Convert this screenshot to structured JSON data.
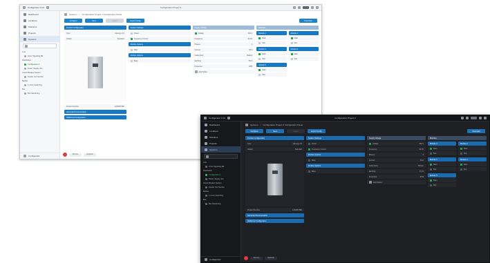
{
  "light": {
    "app_title": "Configurator 2.4.0",
    "window_title": "Configuration Project 1",
    "user_label": "Login",
    "nav": [
      {
        "label": "Dashboard"
      },
      {
        "label": "Locations"
      },
      {
        "label": "Solutions"
      },
      {
        "label": "Projects"
      },
      {
        "label": "Systems"
      }
    ],
    "tree": [
      {
        "label": "Line",
        "group": true
      },
      {
        "label": "xCom Signaling Mk",
        "group": false,
        "sel": false
      },
      {
        "label": "Distribution",
        "group": true
      },
      {
        "label": "Configuration 1",
        "group": false,
        "sel": true
      },
      {
        "label": "Power Supply Unit",
        "group": false,
        "sel": false
      },
      {
        "label": "Circuit Breaker Section",
        "group": true
      },
      {
        "label": "Feeder Unit Section",
        "group": false,
        "sel": false
      },
      {
        "label": "Busbar",
        "group": true
      },
      {
        "label": "1 xCom Switching",
        "group": false,
        "sel": false
      },
      {
        "label": "Bus",
        "group": true
      },
      {
        "label": "Bus Monitoring",
        "group": false,
        "sel": false
      }
    ],
    "footer_label": "Configurator",
    "brand": "EATON",
    "breadcrumb": [
      "Systems",
      "Configuration Project 1 Configuration Panel"
    ],
    "toolbar": [
      "Configure",
      "Save",
      "Import",
      "Export Config",
      "Download"
    ],
    "col1": {
      "head": "Product Configuration",
      "rows": [
        {
          "label": "Type",
          "value": "xEnergy 3.5"
        },
        {
          "label": "Variant",
          "value": "Standard"
        }
      ],
      "meta": {
        "label": "Product Number",
        "value": "1234567890"
      },
      "actions": [
        "Generate Documentation",
        "Additional Configuration"
      ]
    },
    "col2": {
      "groups": [
        {
          "head": "System Settings",
          "rows": [
            "Power",
            "Frequency Control"
          ]
        },
        {
          "head": "Module Options",
          "rows": [
            "Main"
          ]
        },
        {
          "head": "Further Options",
          "rows": [
            "Base"
          ]
        }
      ]
    },
    "col3": {
      "head": "Supply Voltage",
      "rows": [
        {
          "label": "Voltage",
          "value": "400 V"
        },
        {
          "label": "Frequency",
          "value": "50 Hz"
        },
        {
          "label": "Phases",
          "value": "3"
        },
        {
          "label": "Current",
          "value": "63 A"
        },
        {
          "label": "Cable Entry",
          "value": "Bottom"
        },
        {
          "label": "Earthing",
          "value": "TN-S"
        },
        {
          "label": "Protection",
          "value": "IP55"
        },
        {
          "label": "Add Option",
          "value": ""
        }
      ]
    },
    "col4": {
      "head": "Modules",
      "cards": [
        {
          "head": "Module 1",
          "rows": [
            "Main",
            "Slot"
          ]
        },
        {
          "head": "Module 2",
          "rows": [
            "Main",
            "Slot"
          ]
        },
        {
          "head": "Module 3",
          "rows": [
            "Main",
            "Slot"
          ]
        },
        {
          "head": "Module 4",
          "rows": [
            "Main",
            "Slot"
          ]
        },
        {
          "head": "Module 5",
          "rows": [
            "Main",
            "Slot"
          ]
        }
      ]
    },
    "bottom": [
      "Remove",
      "Duplicate"
    ]
  },
  "dark": {
    "app_title": "Configurator 2.4.0",
    "window_title": "Configuration Project 2",
    "user_label": "Login",
    "nav": [
      {
        "label": "Dashboard"
      },
      {
        "label": "Locations"
      },
      {
        "label": "Solutions"
      },
      {
        "label": "Projects"
      },
      {
        "label": "Systems"
      }
    ],
    "tree": [
      {
        "label": "Line",
        "group": true
      },
      {
        "label": "xCom Signaling Mk",
        "group": false,
        "sel": false
      },
      {
        "label": "Distribution",
        "group": true
      },
      {
        "label": "Configuration 1",
        "group": false,
        "sel": true
      },
      {
        "label": "Power Supply Unit",
        "group": false,
        "sel": false
      },
      {
        "label": "Circuit Breaker Section",
        "group": true
      },
      {
        "label": "Feeder Unit Section",
        "group": false,
        "sel": false
      },
      {
        "label": "Busbar",
        "group": true
      },
      {
        "label": "1 xCom Switching",
        "group": false,
        "sel": false
      },
      {
        "label": "Bus",
        "group": true
      },
      {
        "label": "Bus Monitoring",
        "group": false,
        "sel": false
      }
    ],
    "footer_label": "Configurator",
    "breadcrumb": [
      "Systems",
      "Configuration Project 2 Configuration Panel"
    ],
    "toolbar": [
      "Configure",
      "Save",
      "Import",
      "Export Config",
      "Download"
    ],
    "col1": {
      "head": "Product Configuration",
      "rows": [
        {
          "label": "Type",
          "value": "xEnergy 3.5"
        },
        {
          "label": "Variant",
          "value": "Standard"
        }
      ],
      "meta": {
        "label": "Product Number",
        "value": "1234567890"
      },
      "actions": [
        "Generate Documentation",
        "Additional Configuration"
      ]
    },
    "col2": {
      "groups": [
        {
          "head": "System Settings",
          "rows": [
            "Power",
            "Frequency Control"
          ]
        },
        {
          "head": "Module Options",
          "rows": [
            "Main"
          ]
        },
        {
          "head": "Further Options",
          "rows": [
            "Base"
          ]
        }
      ]
    },
    "col3": {
      "head": "Supply Voltage",
      "rows": [
        {
          "label": "Voltage",
          "value": "400 V"
        },
        {
          "label": "Frequency",
          "value": "50 Hz"
        },
        {
          "label": "Phases",
          "value": "3"
        },
        {
          "label": "Current",
          "value": "63 A"
        },
        {
          "label": "Cable Entry",
          "value": "Bottom"
        },
        {
          "label": "Earthing",
          "value": "TN-S"
        },
        {
          "label": "Protection",
          "value": "IP55"
        },
        {
          "label": "Add Option",
          "value": ""
        }
      ]
    },
    "col4": {
      "head": "Modules",
      "cards": [
        {
          "head": "Module 1",
          "rows": [
            "Main",
            "Slot"
          ]
        },
        {
          "head": "Module 2",
          "rows": [
            "Main",
            "Slot"
          ]
        },
        {
          "head": "Module 3",
          "rows": [
            "Main",
            "Slot"
          ]
        },
        {
          "head": "Module 4",
          "rows": [
            "Main",
            "Slot"
          ]
        },
        {
          "head": "Module 5",
          "rows": [
            "Main",
            "Slot"
          ]
        }
      ]
    },
    "bottom": [
      "Remove",
      "Duplicate"
    ]
  },
  "colors": {
    "accent_light": "#1679c5",
    "accent_dark": "#1a6bb0",
    "status_green": "#1ea34a",
    "danger": "#e0393e"
  }
}
